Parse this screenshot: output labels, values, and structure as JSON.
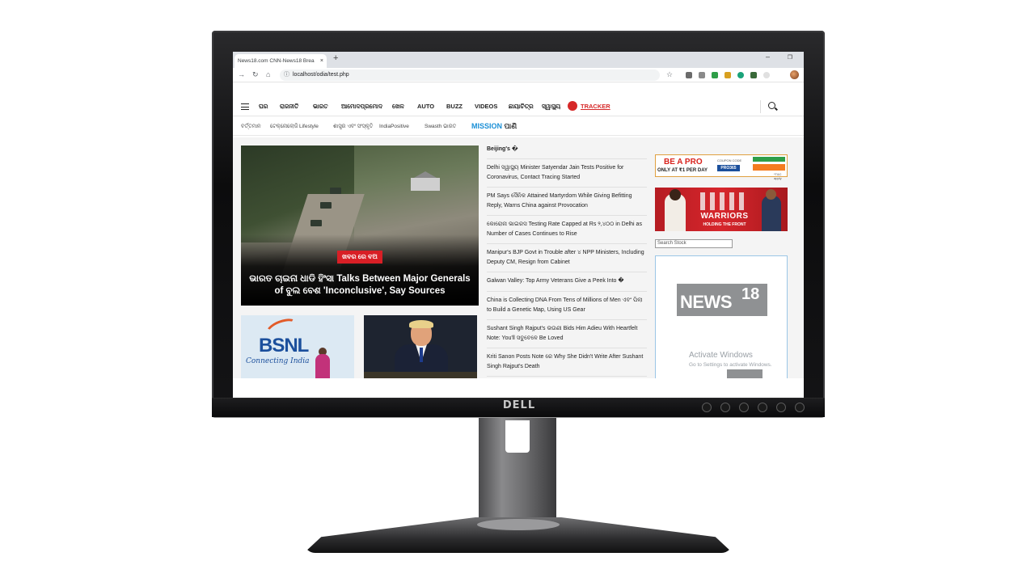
{
  "browser": {
    "tab_title": "News18.com CNN-News18 Brea",
    "tab_close": "×",
    "new_tab": "+",
    "url": "localhost/odia/test.php",
    "minimize": "–",
    "maximize": "❐"
  },
  "monitor": {
    "brand": "DELL"
  },
  "site_nav": {
    "items": [
      "ଘର",
      "ରାଜନୀତି",
      "ଭାରତ",
      "ଆମୋଦପ୍ରମୋଦ",
      "ଖେଳ",
      "AUTO",
      "BUZZ",
      "VIDEOS",
      "ଛାୟାଚିତ୍ର",
      "ସ୍ୱାସ୍ଥ୍ୟ"
    ],
    "tracker": "TRACKER"
  },
  "sub_nav": {
    "items": [
      "ବର୍ତ୍ତମାନ",
      "ଟେକ୍ନୋଲୋଜି",
      "Lifestyle",
      "ଶାସ୍ତ୍ର ଏବଂ ସଂସ୍କୃତି",
      "IndiaPositive",
      "Swasth ଭାରତ"
    ],
    "mission_1": "MISSION",
    "mission_2": "ପାଣି"
  },
  "hero": {
    "badge": "ଖବର ରେ ବଅ",
    "title": "ଭାରତ ଚାଇନା ଧାଡି ହିଂସା Talks Between Major Generals of ବୁଲ ବେଶ 'Inconclusive', Say Sources"
  },
  "thumbs": {
    "bsnl_logo": "BSNL",
    "bsnl_tagline": "Connecting India"
  },
  "headlines": {
    "first": "Beijing's �",
    "items": [
      "Delhi ସ୍ୱାସ୍ଥ୍ୟ Minister Satyendar Jain Tests Positive for Coronavirus, Contact Tracing Started",
      "PM Says ସୈନିକ Attained Martyrdom While Giving Befitting Reply, Warns China against Provocation",
      "କୋରୋନା ଭାଇରସ Testing Rate Capped at Rs ୨,୪୦୦ in Delhi as Number of Cases Continues to Rise",
      "Manipur's BJP Govt in Trouble after ୪ NPP Ministers, Including Deputy CM, Resign from Cabinet",
      "Galwan Valley: Top Army Veterans Give a Peek Into �",
      "China is Collecting DNA From Tens of Millions of Men ଏବଂ ପିଲା to Build a Genetic Map, Using US Gear",
      "Sushant Singh Rajput's ଭଉଣୀ Bids Him Adieu With Heartfelt Note: You'll ସବୁବେଳେ Be Loved",
      "Kriti Sanon Posts Note ରେ Why She Didn't Write After Sushant Singh Rajput's Death"
    ]
  },
  "ads": {
    "ad1_title": "BE A PRO",
    "ad1_sub": "ONLY AT ₹1 PER DAY",
    "ad1_coupon": "COUPON CODE",
    "ad1_code": "PRO365",
    "ad1_tc": "*T&C apply",
    "ad2_title": "WARRIORS",
    "ad2_sub": "HOLDING THE FRONT",
    "search_stock_placeholder": "Search Stock",
    "ad3_logo": "NEWS",
    "ad3_logo_num": "18"
  },
  "watermark": {
    "title": "Activate Windows",
    "sub": "Go to Settings to activate Windows."
  },
  "colors": {
    "accent_red": "#d81f26",
    "mission_blue": "#1a8fd6",
    "tracker_red": "#d62828"
  },
  "icons": [
    "back-icon",
    "forward-icon",
    "reload-icon",
    "home-icon",
    "info-icon",
    "star-icon",
    "hamburger-icon",
    "search-icon",
    "virus-icon"
  ]
}
